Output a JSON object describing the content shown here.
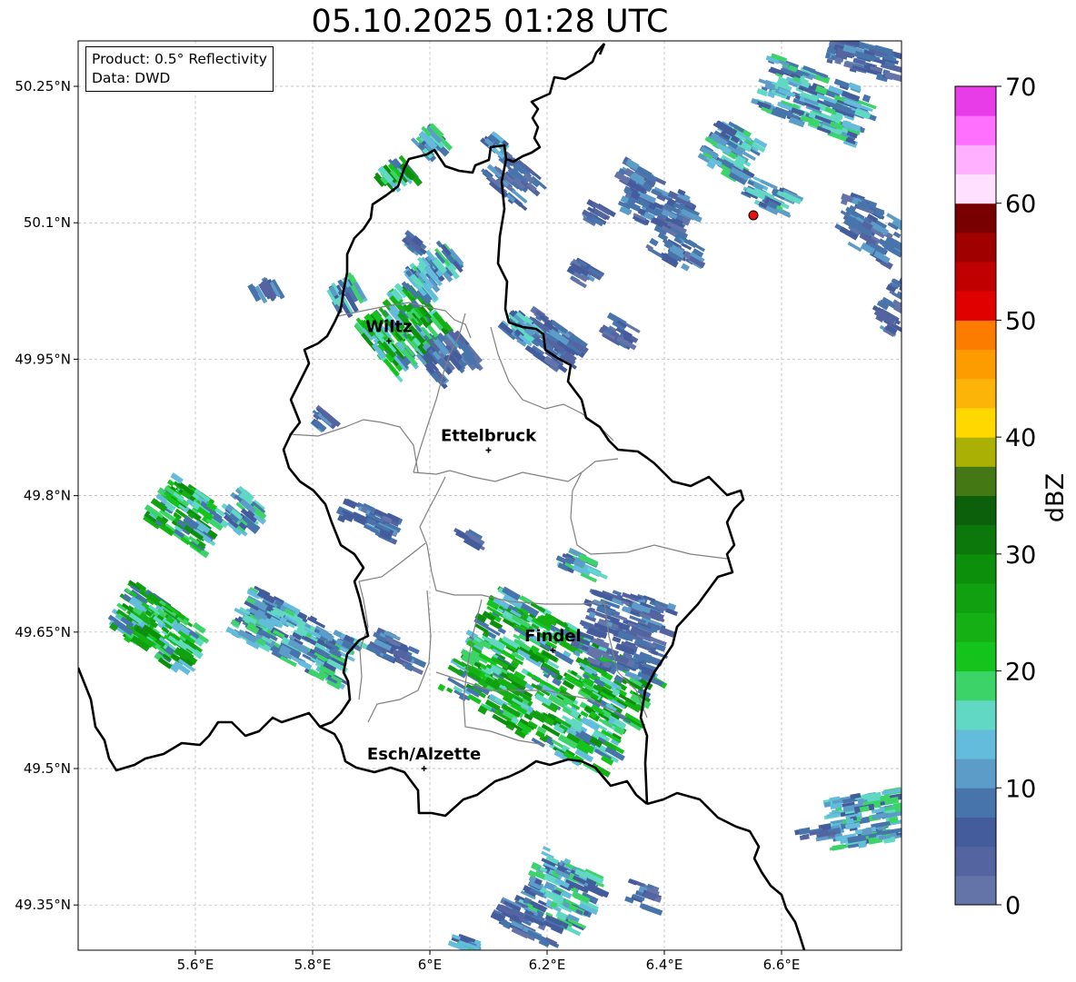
{
  "title": "05.10.2025 01:28 UTC",
  "info": {
    "product": "Product: 0.5° Reflectivity",
    "data": "Data: DWD"
  },
  "map": {
    "lon_range": [
      5.4,
      6.8
    ],
    "lat_range": [
      49.3,
      50.3
    ],
    "lon_ticks": [
      "5.6°E",
      "5.8°E",
      "6°E",
      "6.2°E",
      "6.4°E",
      "6.6°E"
    ],
    "lat_ticks": [
      "50.25°N",
      "50.1°N",
      "49.95°N",
      "49.8°N",
      "49.65°N",
      "49.5°N",
      "49.35°N"
    ],
    "gridlines": true,
    "radar_site_color": "#e81010",
    "border_color": "#000000",
    "canton_border_color": "#808080"
  },
  "cities": [
    {
      "name": "Wiltz",
      "lon": 5.93,
      "lat": 49.97
    },
    {
      "name": "Ettelbruck",
      "lon": 6.1,
      "lat": 49.85
    },
    {
      "name": "Findel",
      "lon": 6.21,
      "lat": 49.63
    },
    {
      "name": "Esch/Alzette",
      "lon": 5.99,
      "lat": 49.5
    }
  ],
  "colorbar": {
    "label": "dBZ",
    "ticks": [
      "0",
      "10",
      "20",
      "30",
      "40",
      "50",
      "60",
      "70"
    ],
    "colors": [
      "#6474a8",
      "#5464a0",
      "#445c9c",
      "#4874ac",
      "#5c9cc8",
      "#64bcdc",
      "#60d8c4",
      "#3cd468",
      "#14c41c",
      "#14b014",
      "#10a010",
      "#0c900c",
      "#0c780c",
      "#0c600c",
      "#447814",
      "#aab004",
      "#ffd800",
      "#fcb408",
      "#fc9c00",
      "#fc7c00",
      "#e00000",
      "#c00000",
      "#a00000",
      "#780000",
      "#ffe0ff",
      "#ffb0ff",
      "#ff70ff",
      "#e83ce8"
    ]
  }
}
